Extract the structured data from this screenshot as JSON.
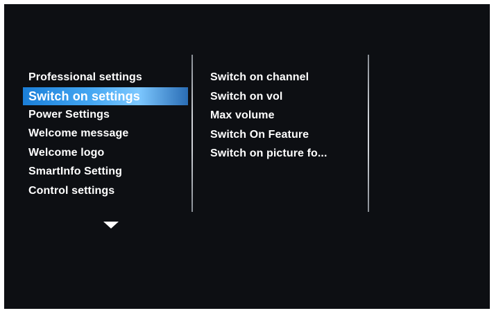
{
  "left_menu": {
    "items": [
      {
        "label": "Professional settings"
      },
      {
        "label": "Switch on settings",
        "selected": true
      },
      {
        "label": "Power Settings"
      },
      {
        "label": "Welcome message"
      },
      {
        "label": "Welcome logo"
      },
      {
        "label": "SmartInfo Setting"
      },
      {
        "label": "Control settings"
      }
    ],
    "scroll_icon": "chevron-down-icon"
  },
  "right_menu": {
    "items": [
      {
        "label": "Switch on channel"
      },
      {
        "label": "Switch on vol"
      },
      {
        "label": "Max volume"
      },
      {
        "label": "Switch On Feature"
      },
      {
        "label": "Switch on picture fo..."
      }
    ]
  },
  "colors": {
    "background": "#0d0f13",
    "highlight": "#43a6f2",
    "text": "#ffffff"
  }
}
